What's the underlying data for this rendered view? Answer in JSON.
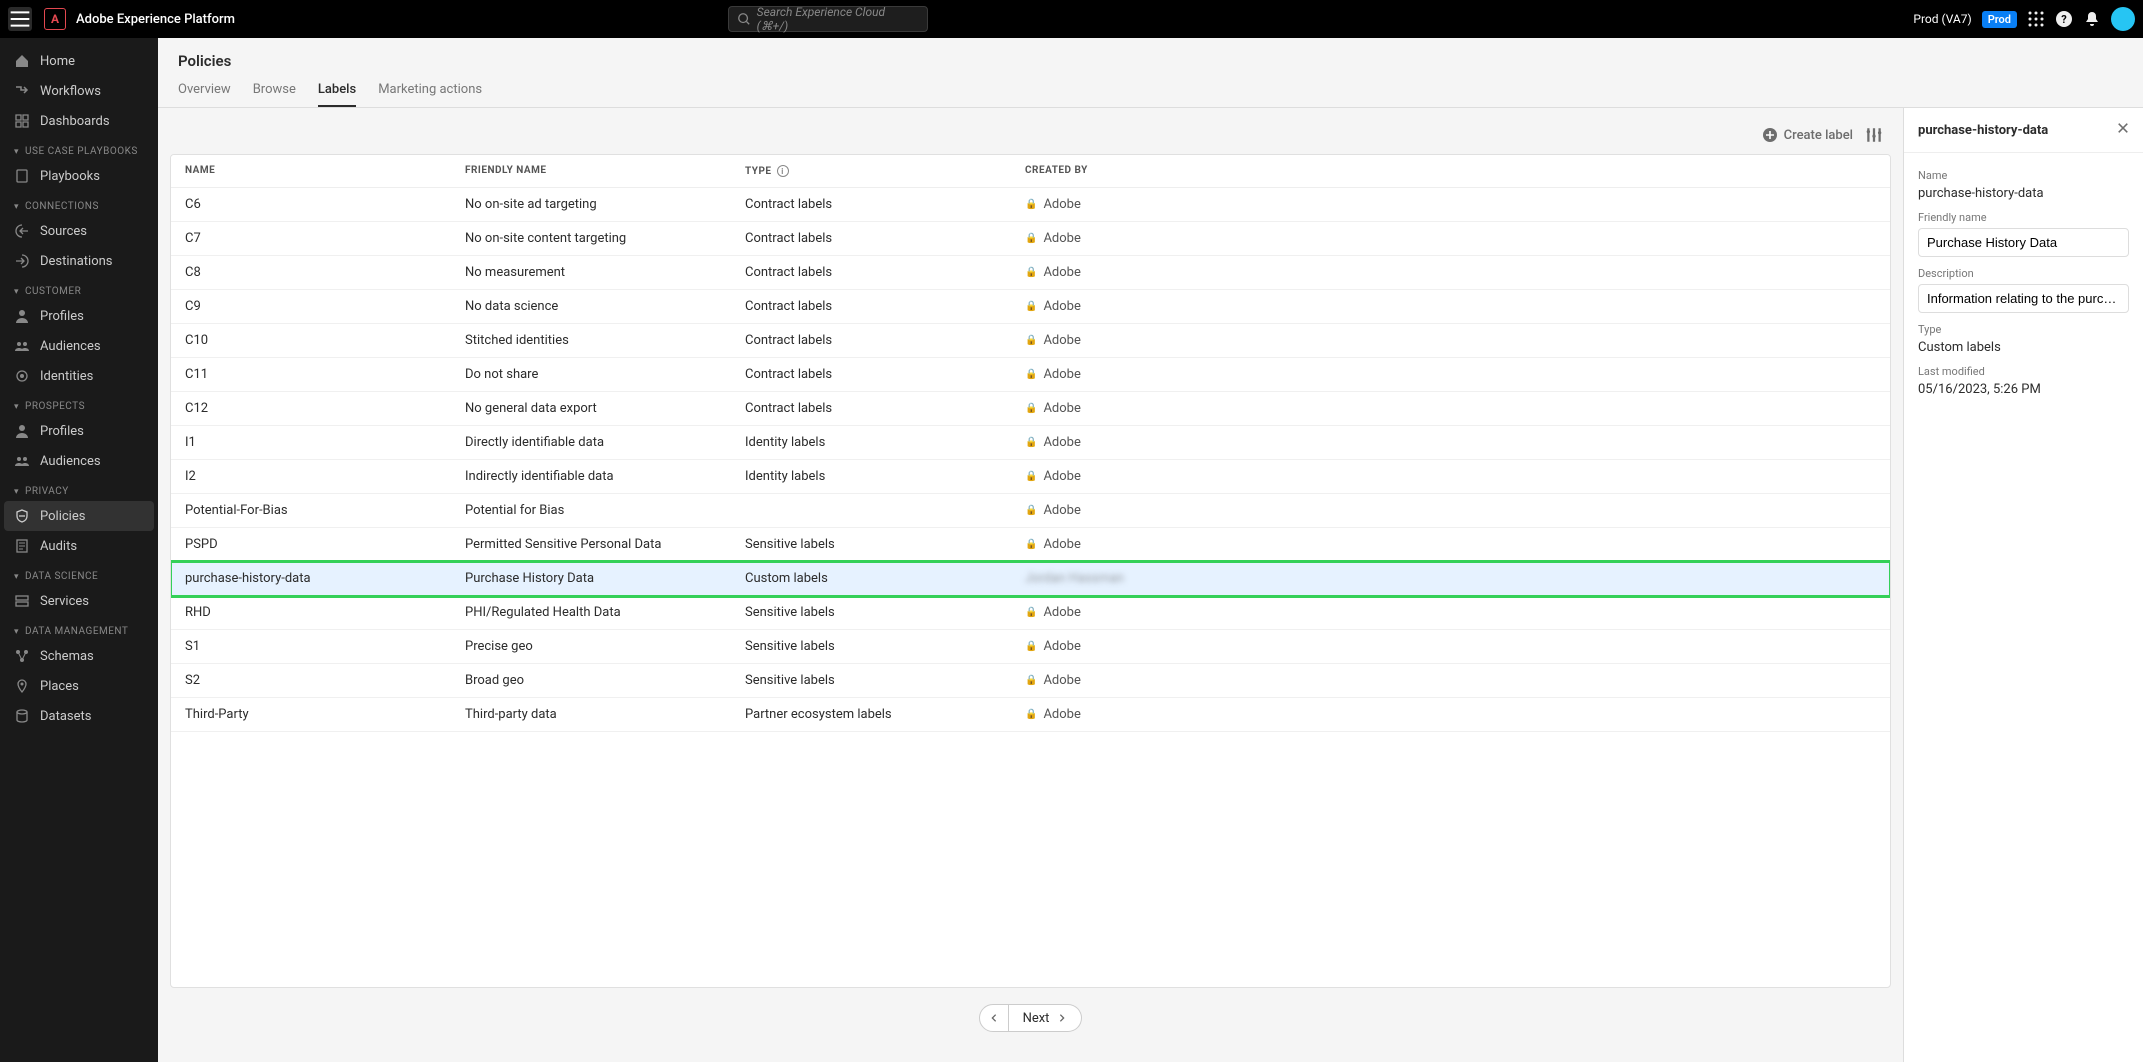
{
  "header": {
    "app_title": "Adobe Experience Platform",
    "search_placeholder": "Search Experience Cloud (⌘+/)",
    "env_label": "Prod (VA7)",
    "env_pill": "Prod"
  },
  "sidebar": {
    "top": [
      {
        "label": "Home"
      },
      {
        "label": "Workflows"
      },
      {
        "label": "Dashboards"
      }
    ],
    "groups": [
      {
        "title": "USE CASE PLAYBOOKS",
        "items": [
          {
            "label": "Playbooks"
          }
        ]
      },
      {
        "title": "CONNECTIONS",
        "items": [
          {
            "label": "Sources"
          },
          {
            "label": "Destinations"
          }
        ]
      },
      {
        "title": "CUSTOMER",
        "items": [
          {
            "label": "Profiles"
          },
          {
            "label": "Audiences"
          },
          {
            "label": "Identities"
          }
        ]
      },
      {
        "title": "PROSPECTS",
        "items": [
          {
            "label": "Profiles"
          },
          {
            "label": "Audiences"
          }
        ]
      },
      {
        "title": "PRIVACY",
        "items": [
          {
            "label": "Policies",
            "active": true
          },
          {
            "label": "Audits"
          }
        ]
      },
      {
        "title": "DATA SCIENCE",
        "items": [
          {
            "label": "Services"
          }
        ]
      },
      {
        "title": "DATA MANAGEMENT",
        "items": [
          {
            "label": "Schemas"
          },
          {
            "label": "Places"
          },
          {
            "label": "Datasets"
          }
        ]
      }
    ]
  },
  "page": {
    "title": "Policies",
    "tabs": [
      "Overview",
      "Browse",
      "Labels",
      "Marketing actions"
    ],
    "active_tab": "Labels",
    "create_label": "Create label"
  },
  "table": {
    "columns": [
      "NAME",
      "FRIENDLY NAME",
      "TYPE",
      "CREATED BY"
    ],
    "rows": [
      {
        "name": "C6",
        "friendly": "No on-site ad targeting",
        "type": "Contract labels",
        "by": "Adobe",
        "locked": true
      },
      {
        "name": "C7",
        "friendly": "No on-site content targeting",
        "type": "Contract labels",
        "by": "Adobe",
        "locked": true
      },
      {
        "name": "C8",
        "friendly": "No measurement",
        "type": "Contract labels",
        "by": "Adobe",
        "locked": true
      },
      {
        "name": "C9",
        "friendly": "No data science",
        "type": "Contract labels",
        "by": "Adobe",
        "locked": true
      },
      {
        "name": "C10",
        "friendly": "Stitched identities",
        "type": "Contract labels",
        "by": "Adobe",
        "locked": true
      },
      {
        "name": "C11",
        "friendly": "Do not share",
        "type": "Contract labels",
        "by": "Adobe",
        "locked": true
      },
      {
        "name": "C12",
        "friendly": "No general data export",
        "type": "Contract labels",
        "by": "Adobe",
        "locked": true
      },
      {
        "name": "I1",
        "friendly": "Directly identifiable data",
        "type": "Identity labels",
        "by": "Adobe",
        "locked": true
      },
      {
        "name": "I2",
        "friendly": "Indirectly identifiable data",
        "type": "Identity labels",
        "by": "Adobe",
        "locked": true
      },
      {
        "name": "Potential-For-Bias",
        "friendly": "Potential for Bias",
        "type": "",
        "by": "Adobe",
        "locked": true
      },
      {
        "name": "PSPD",
        "friendly": "Permitted Sensitive Personal Data",
        "type": "Sensitive labels",
        "by": "Adobe",
        "locked": true
      },
      {
        "name": "purchase-history-data",
        "friendly": "Purchase History Data",
        "type": "Custom labels",
        "by": "Jordan Hassman",
        "locked": false,
        "selected": true,
        "blurred_by": true
      },
      {
        "name": "RHD",
        "friendly": "PHI/Regulated Health Data",
        "type": "Sensitive labels",
        "by": "Adobe",
        "locked": true
      },
      {
        "name": "S1",
        "friendly": "Precise geo",
        "type": "Sensitive labels",
        "by": "Adobe",
        "locked": true
      },
      {
        "name": "S2",
        "friendly": "Broad geo",
        "type": "Sensitive labels",
        "by": "Adobe",
        "locked": true
      },
      {
        "name": "Third-Party",
        "friendly": "Third-party data",
        "type": "Partner ecosystem labels",
        "by": "Adobe",
        "locked": true
      }
    ],
    "pager_next": "Next"
  },
  "detail": {
    "title": "purchase-history-data",
    "name_label": "Name",
    "name_value": "purchase-history-data",
    "friendly_label": "Friendly name",
    "friendly_value": "Purchase History Data",
    "description_label": "Description",
    "description_value": "Information relating to the purchase histor…",
    "type_label": "Type",
    "type_value": "Custom labels",
    "modified_label": "Last modified",
    "modified_value": "05/16/2023, 5:26 PM"
  }
}
